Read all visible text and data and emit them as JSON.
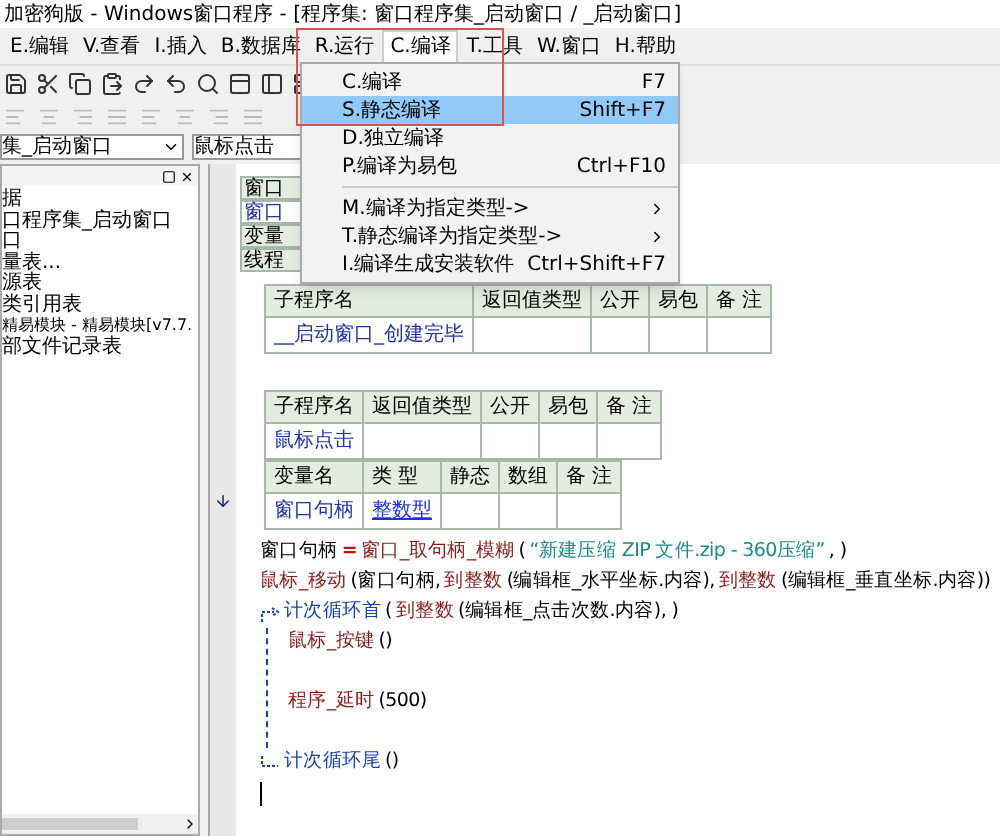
{
  "window": {
    "title": "加密狗版 - Windows窗口程序 - [程序集: 窗口程序集_启动窗口 / _启动窗口]"
  },
  "menu_bar": [
    {
      "label": "E.编辑",
      "selected": false
    },
    {
      "label": "V.查看",
      "selected": false
    },
    {
      "label": "I.插入",
      "selected": false
    },
    {
      "label": "B.数据库",
      "selected": false
    },
    {
      "label": "R.运行",
      "selected": false
    },
    {
      "label": "C.编译",
      "selected": true
    },
    {
      "label": "T.工具",
      "selected": false
    },
    {
      "label": "W.窗口",
      "selected": false
    },
    {
      "label": "H.帮助",
      "selected": false
    }
  ],
  "dropdown_menu": {
    "items": [
      {
        "kind": "item",
        "label": "C.编译",
        "shortcut": "F7",
        "selected": false
      },
      {
        "kind": "item",
        "label": "S.静态编译",
        "shortcut": "Shift+F7",
        "selected": true
      },
      {
        "kind": "item",
        "label": "D.独立编译",
        "selected": false
      },
      {
        "kind": "item",
        "label": "P.编译为易包",
        "shortcut": "Ctrl+F10",
        "selected": false
      },
      {
        "kind": "separator"
      },
      {
        "kind": "submenu",
        "label": "M.编译为指定类型->",
        "selected": false
      },
      {
        "kind": "submenu",
        "label": "T.静态编译为指定类型->",
        "selected": false
      },
      {
        "kind": "item",
        "label": "I.编译生成安装软件",
        "shortcut": "Ctrl+Shift+F7",
        "selected": false
      }
    ]
  },
  "selectors": [
    {
      "value": "集_启动窗口"
    },
    {
      "value": "鼠标点击"
    }
  ],
  "sidebar": {
    "items": [
      {
        "label": "据"
      },
      {
        "label": "口程序集_启动窗口"
      },
      {
        "label": "口"
      },
      {
        "label": "量表..."
      },
      {
        "label": "源表"
      },
      {
        "label": "类引用表"
      },
      {
        "label": "精易模块 - 精易模块[v7.7."
      },
      {
        "label": "部文件记录表"
      }
    ]
  },
  "hidden_table": {
    "rows": [
      "窗口",
      "窗口",
      "变量",
      "线程"
    ]
  },
  "tables": [
    {
      "columns": [
        "子程序名",
        "返回值类型",
        "公开",
        "易包",
        "备 注"
      ],
      "rows": [
        [
          "__启动窗口_创建完毕",
          "",
          "",
          "",
          ""
        ]
      ]
    },
    {
      "columns": [
        "子程序名",
        "返回值类型",
        "公开",
        "易包",
        "备 注"
      ],
      "rows": [
        [
          "鼠标点击",
          "",
          "",
          "",
          ""
        ]
      ]
    },
    {
      "columns": [
        "变量名",
        "类 型",
        "静态",
        "数组",
        "备 注"
      ],
      "rows": [
        [
          "窗口句柄",
          "整数型",
          "",
          "",
          ""
        ]
      ]
    }
  ],
  "code": [
    {
      "kind": "statement",
      "segments": [
        {
          "kind": "var",
          "text": "窗口句柄"
        },
        {
          "kind": "op",
          "text": "="
        },
        {
          "kind": "call",
          "text": "窗口_取句柄_模糊"
        },
        {
          "kind": "plain",
          "text": "("
        },
        {
          "kind": "string",
          "text": "“新建压缩 ZIP 文件.zip - 360压缩”"
        },
        {
          "kind": "plain",
          "text": ", )"
        }
      ]
    },
    {
      "kind": "statement",
      "segments": [
        {
          "kind": "call",
          "text": "鼠标_移动"
        },
        {
          "kind": "plain",
          "text": "(窗口句柄,"
        },
        {
          "kind": "call",
          "text": "到整数"
        },
        {
          "kind": "plain",
          "text": "(编辑框_水平坐标.内容),"
        },
        {
          "kind": "call",
          "text": "到整数"
        },
        {
          "kind": "plain",
          "text": "(编辑框_垂直坐标.内容))"
        }
      ]
    },
    {
      "kind": "loop",
      "segments": [
        {
          "kind": "keyword",
          "text": "计次循环首"
        },
        {
          "kind": "plain",
          "text": "("
        },
        {
          "kind": "call",
          "text": "到整数"
        },
        {
          "kind": "plain",
          "text": "(编辑框_点击次数.内容), )"
        }
      ],
      "children": [
        {
          "kind": "statement",
          "segments": [
            {
              "kind": "call",
              "text": "鼠标_按键"
            },
            {
              "kind": "plain",
              "text": "()"
            }
          ]
        },
        {
          "kind": "blank"
        },
        {
          "kind": "statement",
          "segments": [
            {
              "kind": "call",
              "text": "程序_延时"
            },
            {
              "kind": "plain",
              "text": "(500)"
            }
          ]
        },
        {
          "kind": "blank"
        }
      ],
      "tail": [
        {
          "kind": "keyword",
          "text": "计次循环尾"
        },
        {
          "kind": "plain",
          "text": "()"
        }
      ]
    }
  ]
}
